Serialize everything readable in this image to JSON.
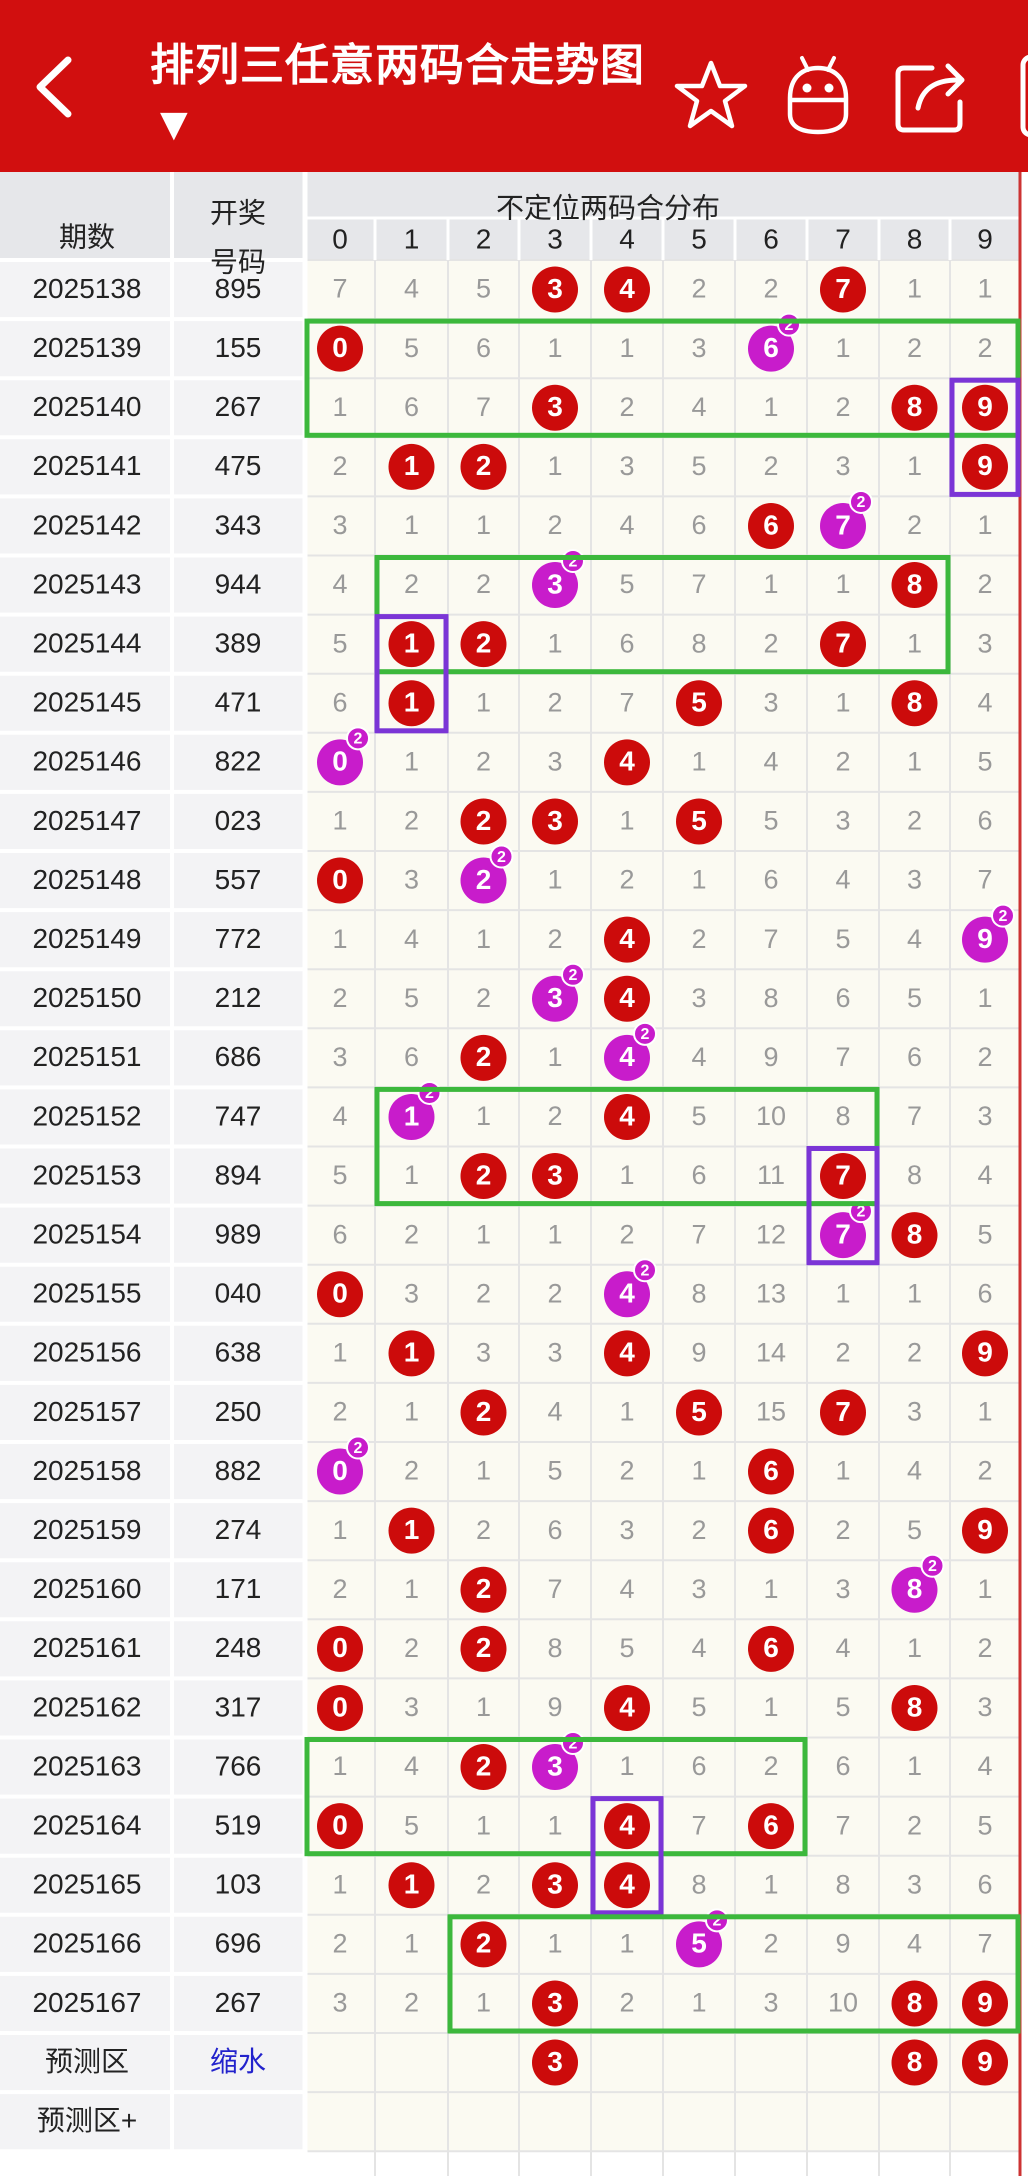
{
  "header": {
    "title": "排列三任意两码合走势图",
    "dropdown_arrow": "▼",
    "icons": [
      "back-arrow-icon",
      "star-icon",
      "robot-icon",
      "share-icon"
    ],
    "background_color": "#d10f0f"
  },
  "table": {
    "col_period": "期数",
    "col_draw": "开奖号码",
    "col_dist": "不定位两码合分布",
    "digits": [
      "0",
      "1",
      "2",
      "3",
      "4",
      "5",
      "6",
      "7",
      "8",
      "9"
    ],
    "colors": {
      "hit": "#cc0b0b",
      "repeat": "#c81ccb",
      "highlight_green": "#3cb83c",
      "highlight_purple": "#7b35d6",
      "miss_text": "#999999"
    },
    "rows": [
      {
        "period": "2025138",
        "draw": "895",
        "cells": [
          "7",
          "4",
          "5",
          "3",
          "4",
          "2",
          "2",
          "7",
          "1",
          "1"
        ],
        "hits": [
          3,
          4,
          7
        ],
        "repeat": []
      },
      {
        "period": "2025139",
        "draw": "155",
        "cells": [
          "0",
          "5",
          "6",
          "1",
          "1",
          "3",
          "6",
          "1",
          "2",
          "2"
        ],
        "hits": [
          0
        ],
        "repeat": [
          6
        ]
      },
      {
        "period": "2025140",
        "draw": "267",
        "cells": [
          "1",
          "6",
          "7",
          "3",
          "2",
          "4",
          "1",
          "2",
          "8",
          "9"
        ],
        "hits": [
          3,
          8,
          9
        ],
        "repeat": []
      },
      {
        "period": "2025141",
        "draw": "475",
        "cells": [
          "2",
          "1",
          "2",
          "1",
          "3",
          "5",
          "2",
          "3",
          "1",
          "9"
        ],
        "hits": [
          1,
          2,
          9
        ],
        "repeat": []
      },
      {
        "period": "2025142",
        "draw": "343",
        "cells": [
          "3",
          "1",
          "1",
          "2",
          "4",
          "6",
          "6",
          "7",
          "2",
          "1"
        ],
        "hits": [
          6
        ],
        "repeat": [
          7
        ]
      },
      {
        "period": "2025143",
        "draw": "944",
        "cells": [
          "4",
          "2",
          "2",
          "3",
          "5",
          "7",
          "1",
          "1",
          "8",
          "2"
        ],
        "hits": [
          8
        ],
        "repeat": [
          3
        ]
      },
      {
        "period": "2025144",
        "draw": "389",
        "cells": [
          "5",
          "1",
          "2",
          "1",
          "6",
          "8",
          "2",
          "7",
          "1",
          "3"
        ],
        "hits": [
          1,
          2,
          7
        ],
        "repeat": []
      },
      {
        "period": "2025145",
        "draw": "471",
        "cells": [
          "6",
          "1",
          "1",
          "2",
          "7",
          "5",
          "3",
          "1",
          "8",
          "4"
        ],
        "hits": [
          1,
          5,
          8
        ],
        "repeat": []
      },
      {
        "period": "2025146",
        "draw": "822",
        "cells": [
          "0",
          "1",
          "2",
          "3",
          "4",
          "1",
          "4",
          "2",
          "1",
          "5"
        ],
        "hits": [
          4
        ],
        "repeat": [
          0
        ]
      },
      {
        "period": "2025147",
        "draw": "023",
        "cells": [
          "1",
          "2",
          "2",
          "3",
          "1",
          "5",
          "5",
          "3",
          "2",
          "6"
        ],
        "hits": [
          2,
          3,
          5
        ],
        "repeat": []
      },
      {
        "period": "2025148",
        "draw": "557",
        "cells": [
          "0",
          "3",
          "2",
          "1",
          "2",
          "1",
          "6",
          "4",
          "3",
          "7"
        ],
        "hits": [
          0
        ],
        "repeat": [
          2
        ]
      },
      {
        "period": "2025149",
        "draw": "772",
        "cells": [
          "1",
          "4",
          "1",
          "2",
          "4",
          "2",
          "7",
          "5",
          "4",
          "9"
        ],
        "hits": [
          4
        ],
        "repeat": [
          9
        ]
      },
      {
        "period": "2025150",
        "draw": "212",
        "cells": [
          "2",
          "5",
          "2",
          "3",
          "4",
          "3",
          "8",
          "6",
          "5",
          "1"
        ],
        "hits": [
          4
        ],
        "repeat": [
          3
        ]
      },
      {
        "period": "2025151",
        "draw": "686",
        "cells": [
          "3",
          "6",
          "2",
          "1",
          "4",
          "4",
          "9",
          "7",
          "6",
          "2"
        ],
        "hits": [
          2
        ],
        "repeat": [
          4
        ]
      },
      {
        "period": "2025152",
        "draw": "747",
        "cells": [
          "4",
          "1",
          "1",
          "2",
          "4",
          "5",
          "10",
          "8",
          "7",
          "3"
        ],
        "hits": [
          4
        ],
        "repeat": [
          1
        ]
      },
      {
        "period": "2025153",
        "draw": "894",
        "cells": [
          "5",
          "1",
          "2",
          "3",
          "1",
          "6",
          "11",
          "7",
          "8",
          "4"
        ],
        "hits": [
          2,
          3,
          7
        ],
        "repeat": []
      },
      {
        "period": "2025154",
        "draw": "989",
        "cells": [
          "6",
          "2",
          "1",
          "1",
          "2",
          "7",
          "12",
          "7",
          "8",
          "5"
        ],
        "hits": [
          8
        ],
        "repeat": [
          7
        ]
      },
      {
        "period": "2025155",
        "draw": "040",
        "cells": [
          "0",
          "3",
          "2",
          "2",
          "4",
          "8",
          "13",
          "1",
          "1",
          "6"
        ],
        "hits": [
          0
        ],
        "repeat": [
          4
        ]
      },
      {
        "period": "2025156",
        "draw": "638",
        "cells": [
          "1",
          "1",
          "3",
          "3",
          "4",
          "9",
          "14",
          "2",
          "2",
          "9"
        ],
        "hits": [
          1,
          4,
          9
        ],
        "repeat": []
      },
      {
        "period": "2025157",
        "draw": "250",
        "cells": [
          "2",
          "1",
          "2",
          "4",
          "1",
          "5",
          "15",
          "7",
          "3",
          "1"
        ],
        "hits": [
          2,
          5,
          7
        ],
        "repeat": []
      },
      {
        "period": "2025158",
        "draw": "882",
        "cells": [
          "0",
          "2",
          "1",
          "5",
          "2",
          "1",
          "6",
          "1",
          "4",
          "2"
        ],
        "hits": [
          6
        ],
        "repeat": [
          0
        ]
      },
      {
        "period": "2025159",
        "draw": "274",
        "cells": [
          "1",
          "1",
          "2",
          "6",
          "3",
          "2",
          "6",
          "2",
          "5",
          "9"
        ],
        "hits": [
          1,
          6,
          9
        ],
        "repeat": []
      },
      {
        "period": "2025160",
        "draw": "171",
        "cells": [
          "2",
          "1",
          "2",
          "7",
          "4",
          "3",
          "1",
          "3",
          "8",
          "1"
        ],
        "hits": [
          2
        ],
        "repeat": [
          8
        ]
      },
      {
        "period": "2025161",
        "draw": "248",
        "cells": [
          "0",
          "2",
          "2",
          "8",
          "5",
          "4",
          "6",
          "4",
          "1",
          "2"
        ],
        "hits": [
          0,
          2,
          6
        ],
        "repeat": []
      },
      {
        "period": "2025162",
        "draw": "317",
        "cells": [
          "0",
          "3",
          "1",
          "9",
          "4",
          "5",
          "1",
          "5",
          "8",
          "3"
        ],
        "hits": [
          0,
          4,
          8
        ],
        "repeat": []
      },
      {
        "period": "2025163",
        "draw": "766",
        "cells": [
          "1",
          "4",
          "2",
          "3",
          "1",
          "6",
          "2",
          "6",
          "1",
          "4"
        ],
        "hits": [
          2
        ],
        "repeat": [
          3
        ]
      },
      {
        "period": "2025164",
        "draw": "519",
        "cells": [
          "0",
          "5",
          "1",
          "1",
          "4",
          "7",
          "6",
          "7",
          "2",
          "5"
        ],
        "hits": [
          0,
          4,
          6
        ],
        "repeat": []
      },
      {
        "period": "2025165",
        "draw": "103",
        "cells": [
          "1",
          "1",
          "2",
          "3",
          "4",
          "8",
          "1",
          "8",
          "3",
          "6"
        ],
        "hits": [
          1,
          3,
          4
        ],
        "repeat": []
      },
      {
        "period": "2025166",
        "draw": "696",
        "cells": [
          "2",
          "1",
          "2",
          "1",
          "1",
          "5",
          "2",
          "9",
          "4",
          "7"
        ],
        "hits": [
          2
        ],
        "repeat": [
          5
        ]
      },
      {
        "period": "2025167",
        "draw": "267",
        "cells": [
          "3",
          "2",
          "1",
          "3",
          "2",
          "1",
          "3",
          "10",
          "8",
          "9"
        ],
        "hits": [
          3,
          8,
          9
        ],
        "repeat": []
      }
    ],
    "predict": {
      "label": "预测区",
      "link": "缩水",
      "cells": [
        "",
        "",
        "",
        "3",
        "",
        "",
        "",
        "",
        "8",
        "9"
      ]
    },
    "predict_plus": {
      "label": "预测区+"
    },
    "repeat_badge": "2"
  }
}
